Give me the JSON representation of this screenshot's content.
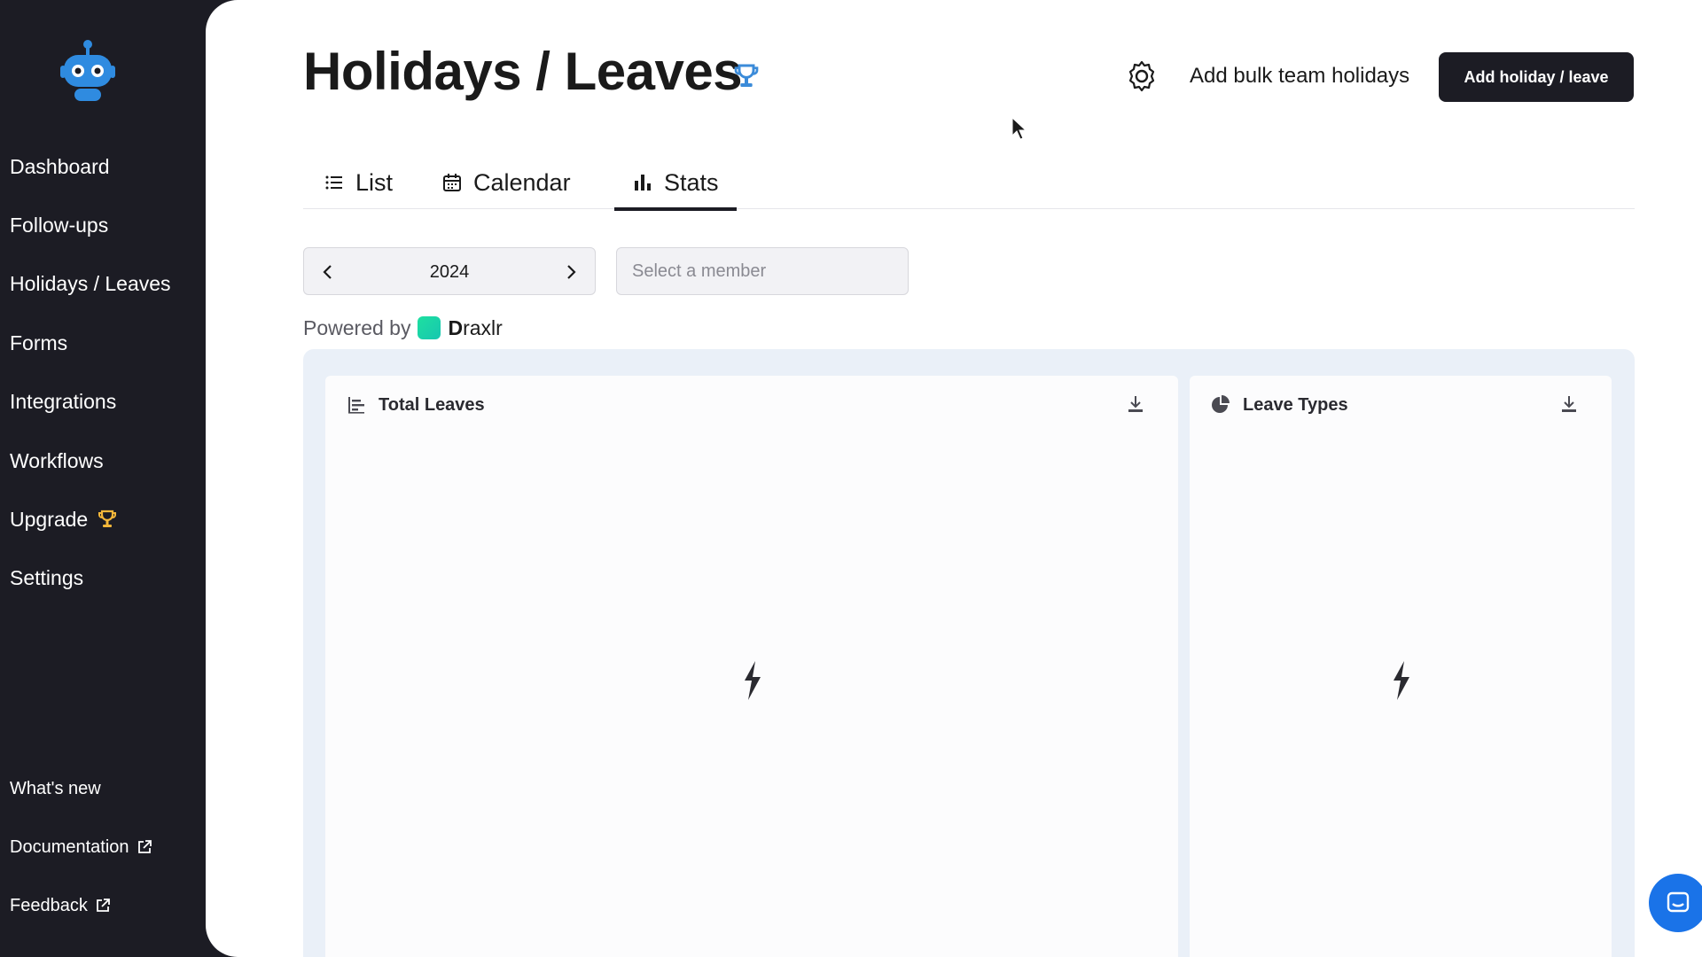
{
  "sidebar": {
    "items": [
      {
        "label": "Dashboard"
      },
      {
        "label": "Follow-ups"
      },
      {
        "label": "Holidays / Leaves"
      },
      {
        "label": "Forms"
      },
      {
        "label": "Integrations"
      },
      {
        "label": "Workflows"
      },
      {
        "label": "Upgrade",
        "icon": "trophy-icon"
      },
      {
        "label": "Settings"
      }
    ],
    "footer": [
      {
        "label": "What's new"
      },
      {
        "label": "Documentation",
        "icon": "external-link-icon"
      },
      {
        "label": "Feedback",
        "icon": "external-link-icon"
      }
    ]
  },
  "header": {
    "title": "Holidays / Leaves",
    "bulk_label": "Add bulk team holidays",
    "add_label": "Add holiday / leave"
  },
  "tabs": [
    {
      "label": "List",
      "icon": "list-icon"
    },
    {
      "label": "Calendar",
      "icon": "calendar-icon"
    },
    {
      "label": "Stats",
      "icon": "bar-chart-icon",
      "active": true
    }
  ],
  "filters": {
    "year": "2024",
    "member_placeholder": "Select a member"
  },
  "powered_by": {
    "prefix": "Powered by",
    "brand_bold": "D",
    "brand_rest": "raxlr"
  },
  "cards": [
    {
      "title": "Total Leaves",
      "icon": "bar-chart-horizontal-icon"
    },
    {
      "title": "Leave Types",
      "icon": "pie-chart-icon"
    }
  ],
  "colors": {
    "sidebar_bg": "#1c1c24",
    "accent_trophy_sidebar": "#f4b73a",
    "accent_trophy_title": "#3b8bd9",
    "primary_button": "#1c1c24",
    "dash_bg": "#eaf0f8",
    "chat_bubble": "#1a73e8"
  }
}
